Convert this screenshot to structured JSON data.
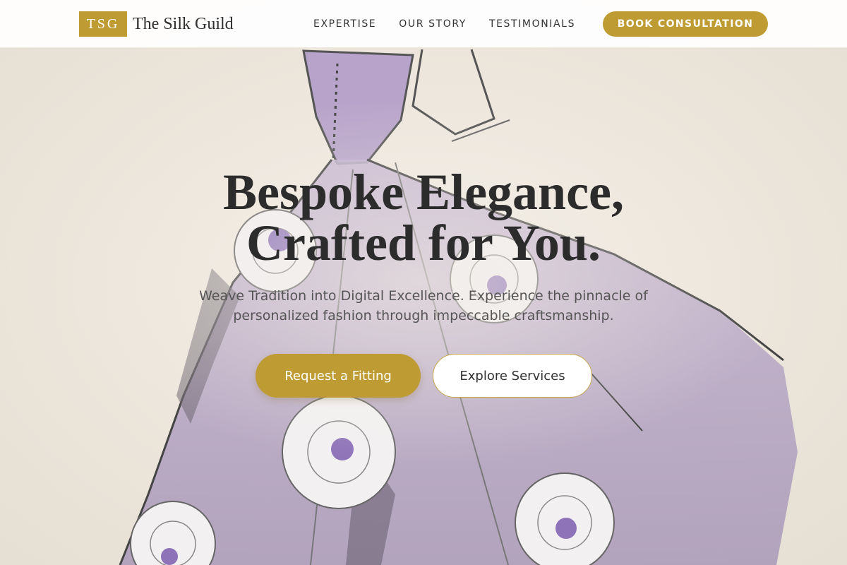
{
  "brand": {
    "mark": "TSG",
    "name": "The Silk Guild"
  },
  "nav": {
    "links": [
      "EXPERTISE",
      "OUR STORY",
      "TESTIMONIALS"
    ],
    "cta_label": "BOOK CONSULTATION"
  },
  "hero": {
    "title_line1": "Bespoke Elegance,",
    "title_line2": "Crafted for You.",
    "subtitle_line1": "Weave Tradition into Digital Excellence. Experience the pinnacle of",
    "subtitle_line2": "personalized fashion through impeccable craftsmanship.",
    "primary_button": "Request a Fitting",
    "secondary_button": "Explore Services",
    "background_icon": "gown-sketch-illustration"
  },
  "colors": {
    "accent": "#bf9b33",
    "text": "#2c2c2c",
    "gown": "#b6a3c6",
    "background": "#efe9df"
  }
}
